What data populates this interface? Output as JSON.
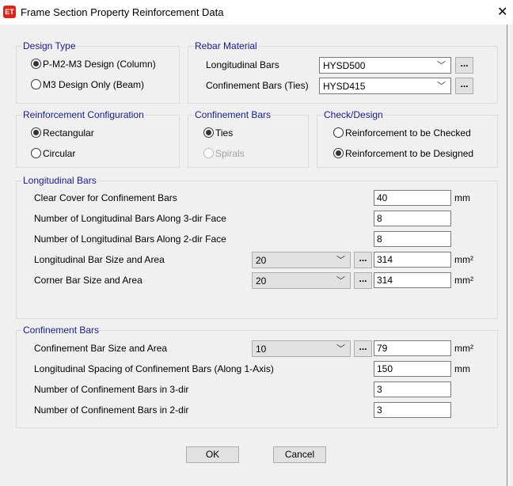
{
  "window": {
    "title": "Frame Section Property Reinforcement Data",
    "logo": "ET",
    "close": "✕"
  },
  "design_type": {
    "label": "Design Type",
    "options": [
      "P-M2-M3 Design  (Column)",
      "M3 Design Only  (Beam)"
    ],
    "selected": 0
  },
  "rebar_material": {
    "label": "Rebar Material",
    "longitudinal_label": "Longitudinal Bars",
    "longitudinal_value": "HYSD500",
    "confinement_label": "Confinement Bars (Ties)",
    "confinement_value": "HYSD415"
  },
  "reinforcement_config": {
    "label": "Reinforcement Configuration",
    "options": [
      "Rectangular",
      "Circular"
    ],
    "selected": 0
  },
  "confinement_type": {
    "label": "Confinement Bars",
    "options": [
      "Ties",
      "Spirals"
    ],
    "selected": 0
  },
  "check_design": {
    "label": "Check/Design",
    "options": [
      "Reinforcement to be Checked",
      "Reinforcement to be Designed"
    ],
    "selected": 1
  },
  "longitudinal": {
    "label": "Longitudinal Bars",
    "rows": [
      {
        "label": "Clear Cover for Confinement Bars",
        "value": "40",
        "unit": "mm"
      },
      {
        "label": "Number of Longitudinal Bars Along 3-dir Face",
        "value": "8",
        "unit": ""
      },
      {
        "label": "Number of Longitudinal Bars Along 2-dir Face",
        "value": "8",
        "unit": ""
      },
      {
        "label": "Longitudinal Bar Size and Area",
        "size": "20",
        "value": "314",
        "unit": "mm²"
      },
      {
        "label": "Corner Bar Size and Area",
        "size": "20",
        "value": "314",
        "unit": "mm²"
      }
    ]
  },
  "confinement": {
    "label": "Confinement Bars",
    "rows": [
      {
        "label": "Confinement Bar Size and Area",
        "size": "10",
        "value": "79",
        "unit": "mm²"
      },
      {
        "label": "Longitudinal Spacing of Confinement Bars  (Along 1-Axis)",
        "value": "150",
        "unit": "mm"
      },
      {
        "label": "Number of Confinement Bars in 3-dir",
        "value": "3",
        "unit": ""
      },
      {
        "label": "Number of Confinement Bars in 2-dir",
        "value": "3",
        "unit": ""
      }
    ]
  },
  "ellipsis": "...",
  "chevron": "﹀",
  "buttons": {
    "ok": "OK",
    "cancel": "Cancel"
  }
}
